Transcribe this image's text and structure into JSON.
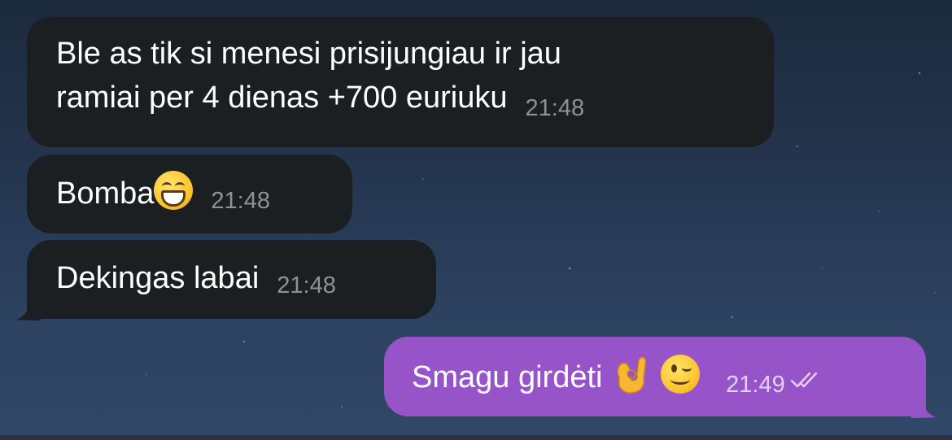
{
  "colors": {
    "incoming_bubble": "#1c1f22",
    "outgoing_bubble": "#9654c8",
    "background": "#23344c"
  },
  "messages": [
    {
      "direction": "incoming",
      "line1": "Ble as tik si menesi prisijungiau ir jau",
      "line2": "ramiai per 4 dienas +700 euriuku",
      "time": "21:48"
    },
    {
      "direction": "incoming",
      "text": "Bomba",
      "emoji": "grinning-face-with-smiling-eyes",
      "time": "21:48"
    },
    {
      "direction": "incoming",
      "text": "Dekingas labai",
      "time": "21:48"
    },
    {
      "direction": "outgoing",
      "text": "Smagu girdėti",
      "emojis": [
        "ok-hand",
        "winking-face"
      ],
      "time": "21:49",
      "status_icon": "double-check-read-icon"
    }
  ]
}
